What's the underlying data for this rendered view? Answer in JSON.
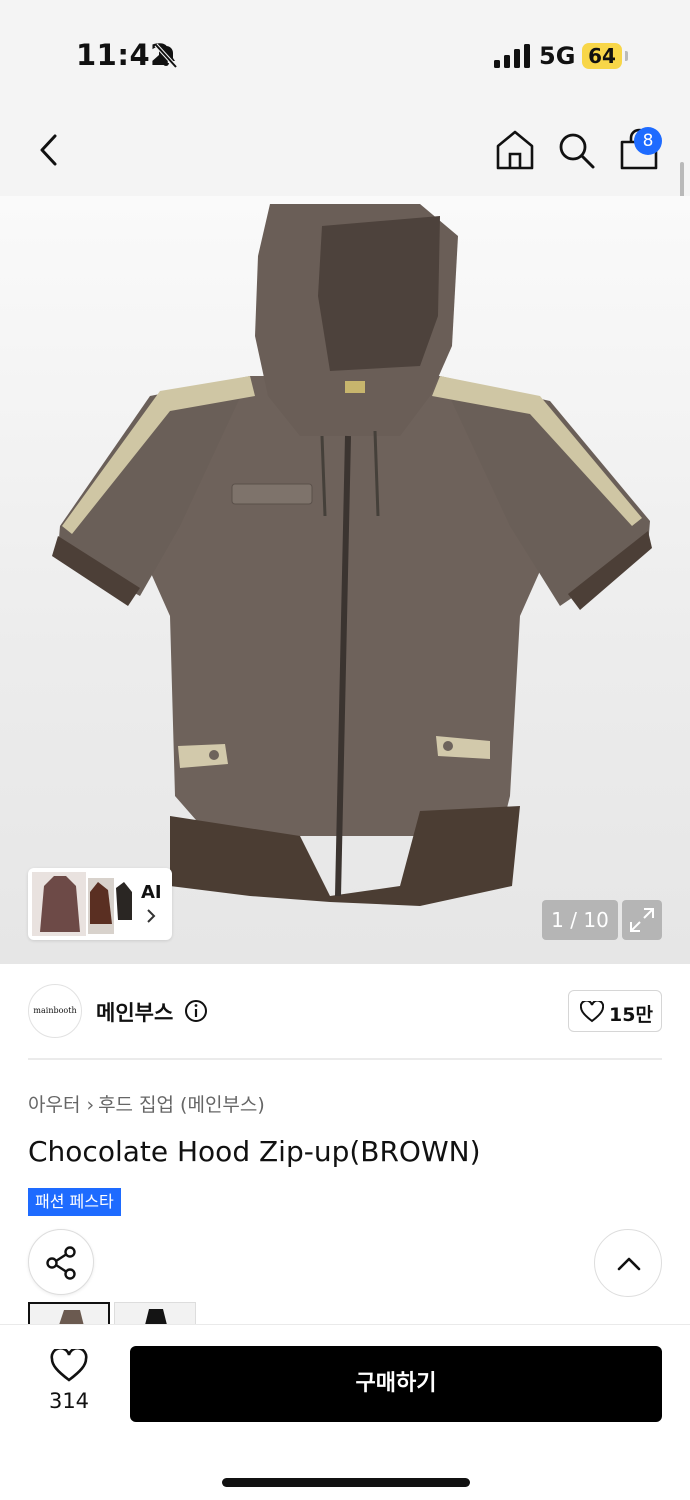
{
  "status_bar": {
    "time": "11:42",
    "network": "5G",
    "battery": "64",
    "icons": [
      "bell-slash-icon",
      "signal-icon",
      "battery-icon"
    ]
  },
  "nav": {
    "icons": [
      "back-arrow-icon",
      "home-icon",
      "search-icon",
      "shopping-bag-icon"
    ],
    "cart_count": "8"
  },
  "gallery": {
    "ai_label": "AI",
    "counter": "1 / 10",
    "expand_icon": "expand-icon"
  },
  "brand": {
    "logo_text": "mainbooth",
    "name": "메인부스",
    "likes": "15만"
  },
  "product": {
    "breadcrumb": [
      "아우터",
      "후드 집업 (메인부스)"
    ],
    "title": "Chocolate Hood Zip-up(BROWN)",
    "tag": "패션 페스타",
    "partially_hidden_text": "!"
  },
  "bottom_bar": {
    "like_count": "314",
    "buy_label": "구매하기"
  },
  "colors": {
    "accent_blue": "#1e6bff",
    "battery_yellow": "#f8d648",
    "buy_button": "#000000"
  }
}
